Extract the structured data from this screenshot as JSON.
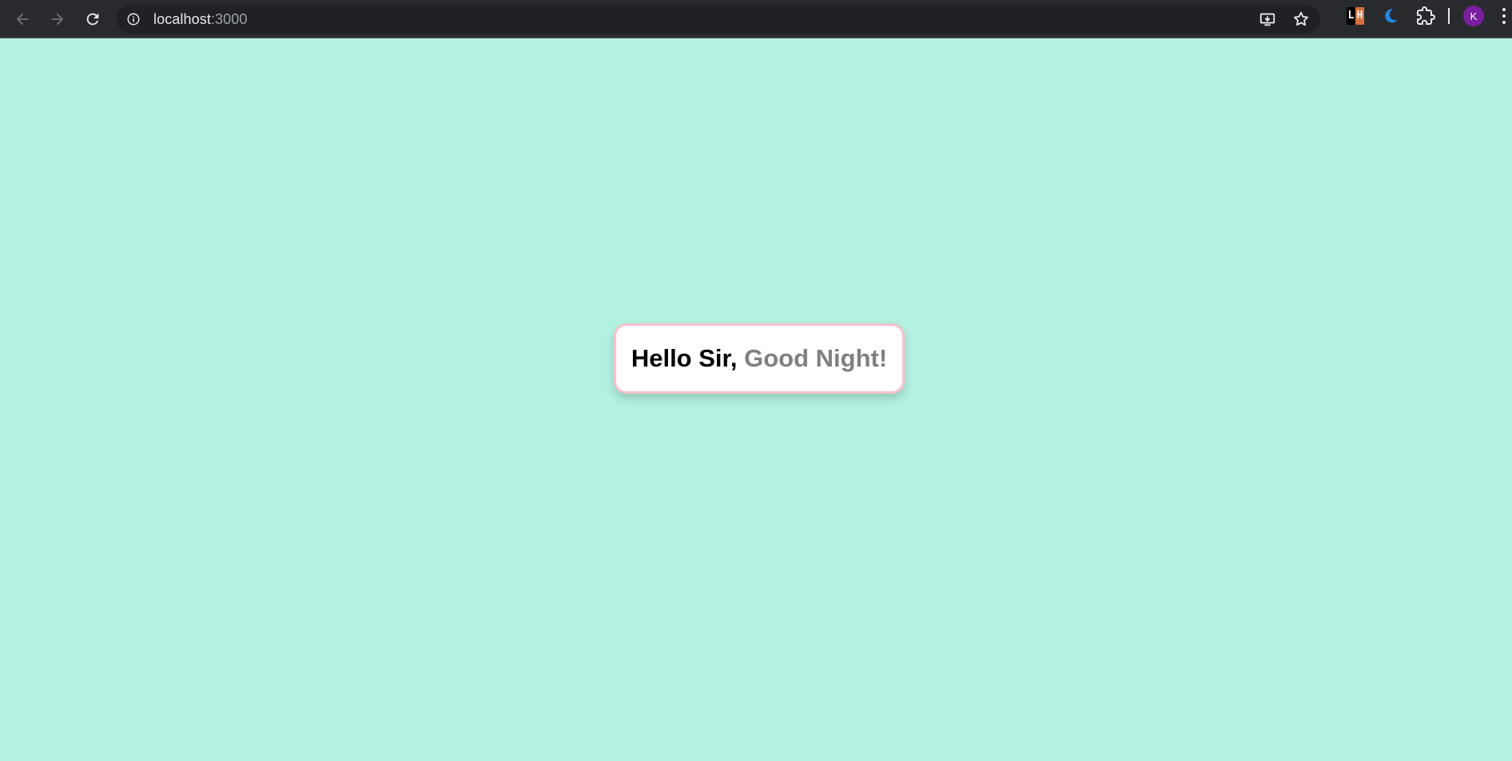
{
  "browser": {
    "url_host": "localhost",
    "url_port": ":3000",
    "profile_initial": "K",
    "lighthouse_badge": {
      "left": "L",
      "right": "H"
    }
  },
  "page": {
    "greeting_hello": "Hello Sir, ",
    "greeting_time": "Good Night!",
    "colors": {
      "background": "#b3f2e1",
      "card_background": "#ffffff",
      "card_border": "#ffc0cb",
      "hello_text": "#000000",
      "time_text": "#808080"
    }
  },
  "icons": {
    "back": "arrow-left-icon",
    "forward": "arrow-right-icon",
    "reload": "reload-icon",
    "site_info": "info-icon",
    "install": "install-app-icon",
    "bookmark": "star-icon",
    "dark_mode": "moon-icon",
    "extensions": "puzzle-icon",
    "menu": "kebab-menu-icon"
  }
}
